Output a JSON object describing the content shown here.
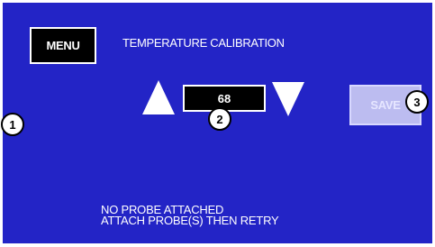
{
  "screen": {
    "title": "TEMPERATURE CALIBRATION",
    "background_color": "#2324c6"
  },
  "menu_button": {
    "label": "MENU"
  },
  "temperature": {
    "value": "68",
    "increase_icon": "triangle-up-icon",
    "decrease_icon": "triangle-down-icon"
  },
  "save_button": {
    "label": "SAVE",
    "state": "disabled"
  },
  "status": {
    "line1": "NO PROBE ATTACHED",
    "line2": "ATTACH PROBE(S) THEN RETRY"
  },
  "callouts": [
    "1",
    "2",
    "3"
  ]
}
